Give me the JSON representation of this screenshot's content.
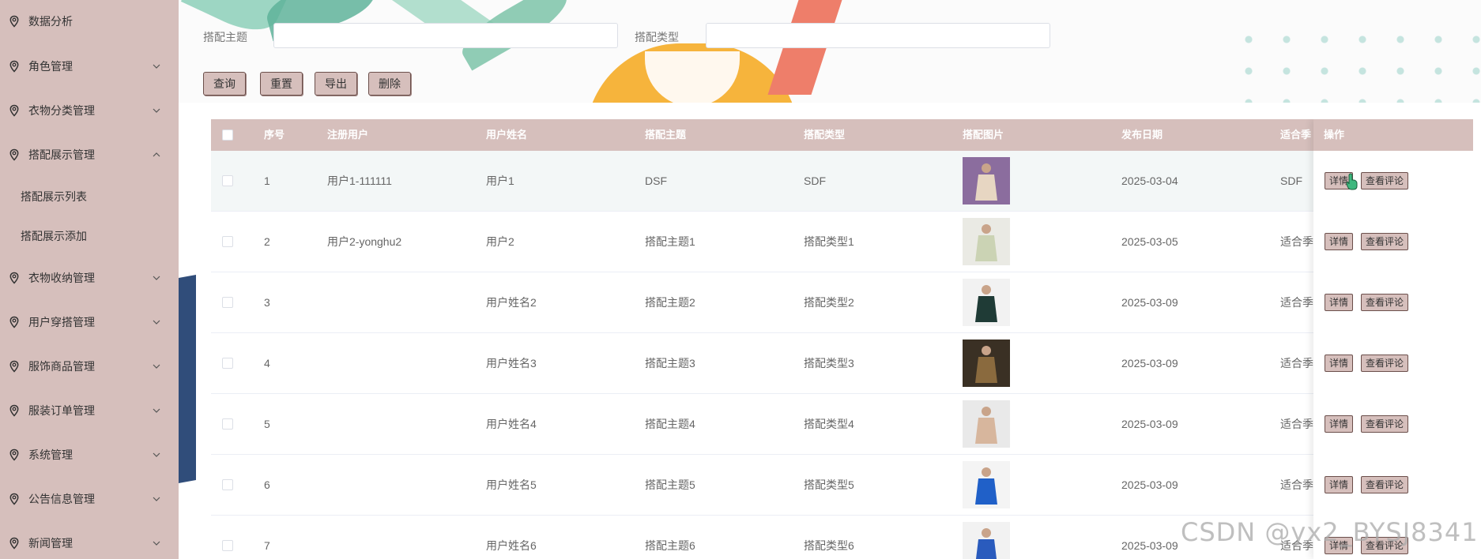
{
  "sidebar": {
    "items": [
      {
        "label": "数据分析",
        "icon": "location-pin-icon",
        "chevron": ""
      },
      {
        "label": "角色管理",
        "icon": "location-pin-icon",
        "chevron": "down"
      },
      {
        "label": "衣物分类管理",
        "icon": "location-pin-icon",
        "chevron": "down"
      },
      {
        "label": "搭配展示管理",
        "icon": "location-pin-icon",
        "chevron": "up"
      },
      {
        "label": "衣物收纳管理",
        "icon": "location-pin-icon",
        "chevron": "down"
      },
      {
        "label": "用户穿搭管理",
        "icon": "location-pin-icon",
        "chevron": "down"
      },
      {
        "label": "服饰商品管理",
        "icon": "location-pin-icon",
        "chevron": "down"
      },
      {
        "label": "服装订单管理",
        "icon": "location-pin-icon",
        "chevron": "down"
      },
      {
        "label": "系统管理",
        "icon": "location-pin-icon",
        "chevron": "down"
      },
      {
        "label": "公告信息管理",
        "icon": "location-pin-icon",
        "chevron": "down"
      },
      {
        "label": "新闻管理",
        "icon": "location-pin-icon",
        "chevron": "down"
      }
    ],
    "sub_items": [
      {
        "label": "搭配展示列表"
      },
      {
        "label": "搭配展示添加"
      }
    ]
  },
  "search": {
    "theme_label": "搭配主题",
    "theme_value": "",
    "type_label": "搭配类型",
    "type_value": ""
  },
  "buttons": {
    "query": "查询",
    "reset": "重置",
    "export": "导出",
    "delete": "删除"
  },
  "table": {
    "headers": {
      "index": "序号",
      "user": "注册用户",
      "name": "用户姓名",
      "theme": "搭配主题",
      "type": "搭配类型",
      "image": "搭配图片",
      "date": "发布日期",
      "season": "适合季",
      "ops": "操作"
    },
    "detail_label": "详情",
    "comment_label": "查看评论",
    "rows": [
      {
        "index": "1",
        "user": "用户1-111111",
        "name": "用户1",
        "theme": "DSF",
        "type": "SDF",
        "date": "2025-03-04",
        "season": "SDF",
        "image": "outfit-photo"
      },
      {
        "index": "2",
        "user": "用户2-yonghu2",
        "name": "用户2",
        "theme": "搭配主题1",
        "type": "搭配类型1",
        "date": "2025-03-05",
        "season": "适合季",
        "image": "outfit-photo"
      },
      {
        "index": "3",
        "user": "",
        "name": "用户姓名2",
        "theme": "搭配主题2",
        "type": "搭配类型2",
        "date": "2025-03-09",
        "season": "适合季",
        "image": "outfit-photo"
      },
      {
        "index": "4",
        "user": "",
        "name": "用户姓名3",
        "theme": "搭配主题3",
        "type": "搭配类型3",
        "date": "2025-03-09",
        "season": "适合季",
        "image": "outfit-photo"
      },
      {
        "index": "5",
        "user": "",
        "name": "用户姓名4",
        "theme": "搭配主题4",
        "type": "搭配类型4",
        "date": "2025-03-09",
        "season": "适合季",
        "image": "outfit-photo"
      },
      {
        "index": "6",
        "user": "",
        "name": "用户姓名5",
        "theme": "搭配主题5",
        "type": "搭配类型5",
        "date": "2025-03-09",
        "season": "适合季",
        "image": "outfit-photo"
      },
      {
        "index": "7",
        "user": "",
        "name": "用户姓名6",
        "theme": "搭配主题6",
        "type": "搭配类型6",
        "date": "2025-03-09",
        "season": "适合季",
        "image": "outfit-photo"
      }
    ]
  },
  "watermark": "CSDN @yx2_BYSJ8341",
  "colors": {
    "sidebar_bg": "#d6bfbc",
    "header_bg": "#d6bfbc",
    "button_border": "#6b4f4b",
    "row_highlight": "#f3f7f7"
  }
}
